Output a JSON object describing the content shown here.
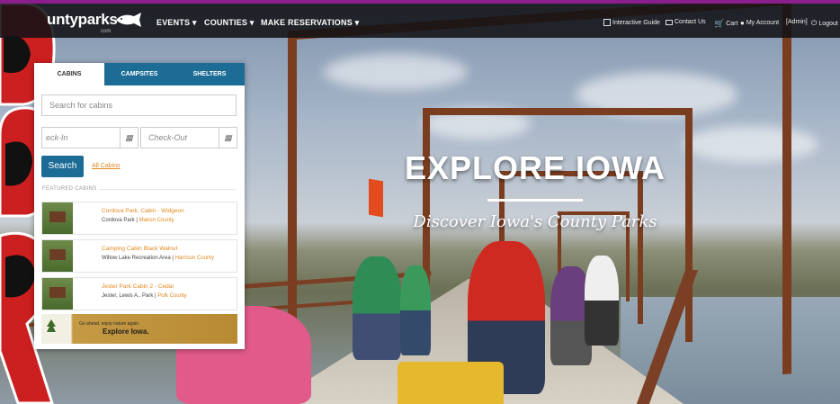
{
  "brand": {
    "logo_text": "untyparks",
    "logo_sub": "com"
  },
  "nav": {
    "items": [
      "EVENTS ▾",
      "COUNTIES ▾",
      "MAKE RESERVATIONS ▾"
    ]
  },
  "utility": {
    "guide": "Interactive Guide",
    "contact": "Contact Us",
    "cart": "Cart",
    "account": "My Account",
    "admin": "[Admin]",
    "logout": "Logout"
  },
  "hero": {
    "title": "EXPLORE IOWA",
    "subtitle": "Discover Iowa's County Parks"
  },
  "widget": {
    "tabs": [
      "CABINS",
      "CAMPSITES",
      "SHELTERS"
    ],
    "search_placeholder": "Search for cabins",
    "checkin_placeholder": "eck-In",
    "checkout_placeholder": "Check-Out",
    "search_button": "Search",
    "all_link": "All Cabins",
    "featured_title": "FEATURED CABINS",
    "cards": [
      {
        "name": "Cordova Park, Cabin - Widgeon",
        "park": "Cordova Park",
        "county": "Marion County"
      },
      {
        "name": "Camping Cabin Black Walnut",
        "park": "Willow Lake Recreation Area",
        "county": "Harrison County"
      },
      {
        "name": "Jester Park Cabin 2 - Cedar",
        "park": "Jester, Lewis A., Park",
        "county": "Polk County"
      }
    ],
    "ad": {
      "small": "Go ahead, enjoy nature again.",
      "big": "Explore Iowa."
    }
  },
  "colors": {
    "accent": "#1d6c96",
    "link": "#e0881e",
    "topbar_stripe": "#8a1e8c",
    "deco_red": "#cc1f1f"
  }
}
